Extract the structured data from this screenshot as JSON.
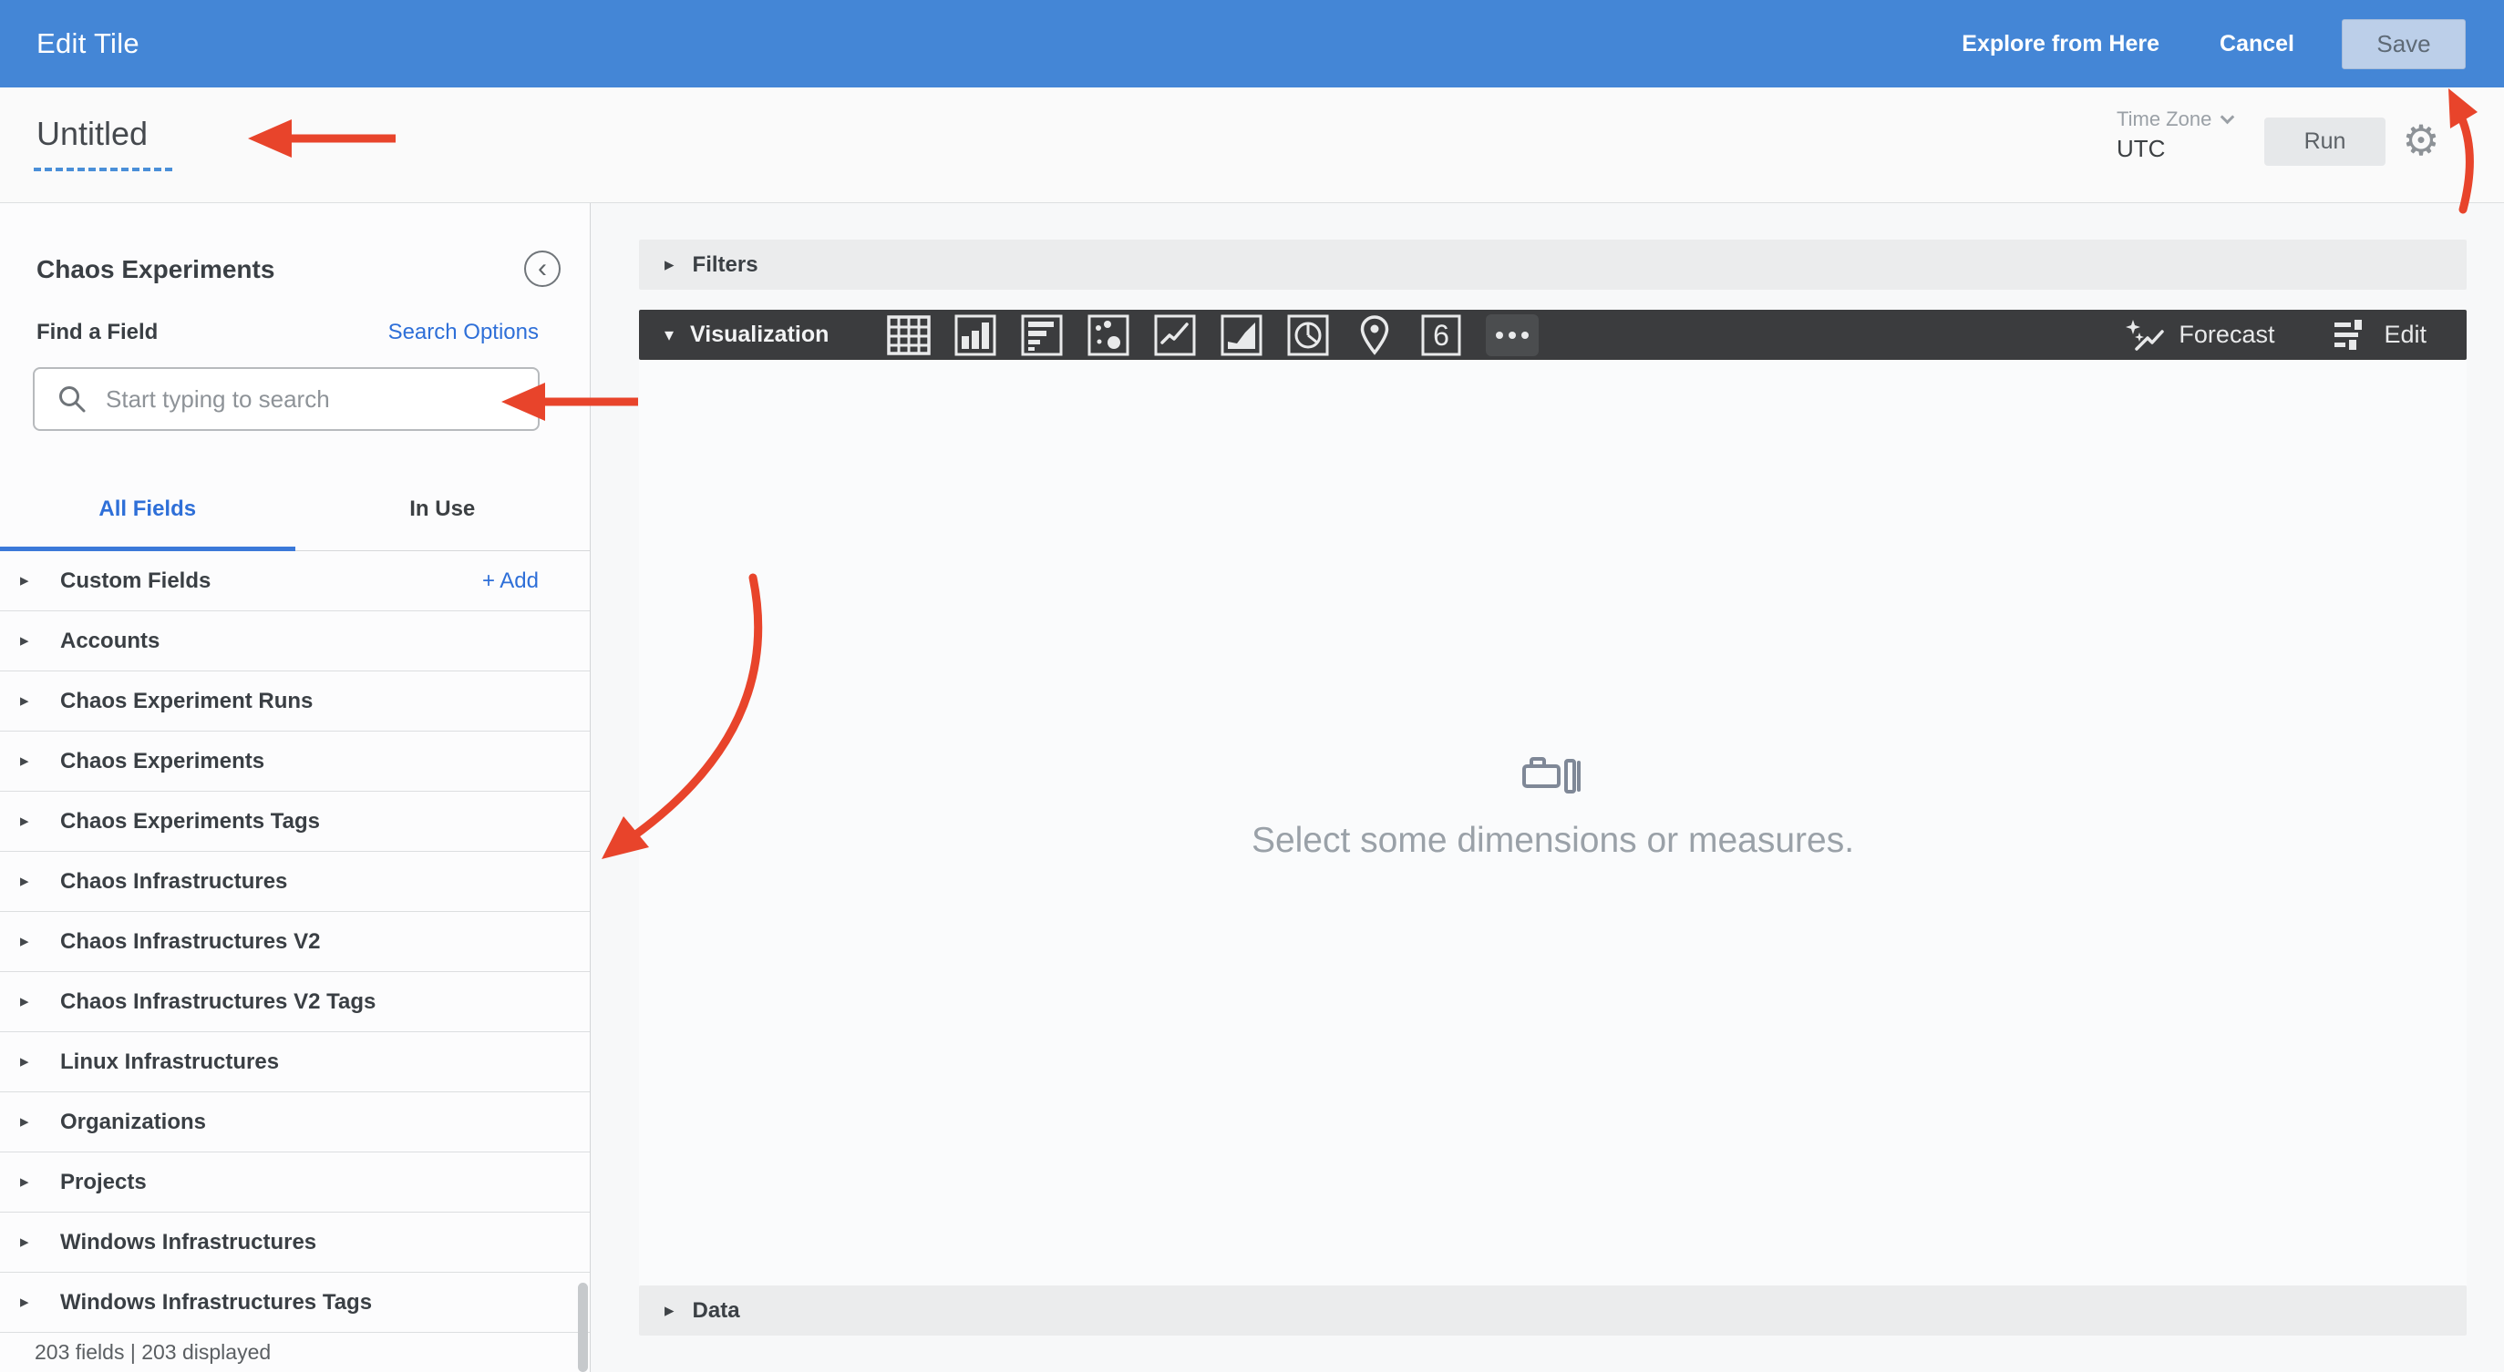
{
  "topbar": {
    "title": "Edit Tile",
    "explore_label": "Explore from Here",
    "cancel_label": "Cancel",
    "save_label": "Save"
  },
  "header": {
    "tile_title": "Untitled",
    "timezone_label": "Time Zone",
    "timezone_value": "UTC",
    "run_label": "Run"
  },
  "sidebar": {
    "title": "Chaos Experiments",
    "find_label": "Find a Field",
    "search_options_label": "Search Options",
    "search_placeholder": "Start typing to search",
    "tabs": [
      {
        "label": "All Fields",
        "active": true
      },
      {
        "label": "In Use",
        "active": false
      }
    ],
    "add_label": "+ Add",
    "fields": [
      {
        "label": "Custom Fields"
      },
      {
        "label": "Accounts"
      },
      {
        "label": "Chaos Experiment Runs"
      },
      {
        "label": "Chaos Experiments"
      },
      {
        "label": "Chaos Experiments Tags"
      },
      {
        "label": "Chaos Infrastructures"
      },
      {
        "label": "Chaos Infrastructures V2"
      },
      {
        "label": "Chaos Infrastructures V2 Tags"
      },
      {
        "label": "Linux Infrastructures"
      },
      {
        "label": "Organizations"
      },
      {
        "label": "Projects"
      },
      {
        "label": "Windows Infrastructures"
      },
      {
        "label": "Windows Infrastructures Tags"
      }
    ],
    "footer": "203 fields | 203 displayed"
  },
  "main": {
    "filters_label": "Filters",
    "visualization_label": "Visualization",
    "viz_types": [
      "table",
      "column",
      "bar",
      "scatter",
      "line",
      "area",
      "pie",
      "map",
      "single-value",
      "more-options"
    ],
    "forecast_label": "Forecast",
    "edit_label": "Edit",
    "empty_state_text": "Select some dimensions or measures.",
    "data_label": "Data"
  },
  "icons": {
    "search": "magnifier",
    "settings": "gear",
    "collapse_panel": "chevron-left-circle",
    "timezone": "chevron-down",
    "empty_state": "flashlight",
    "forecast": "sparkle-trend",
    "edit": "sliders"
  },
  "annotations": {
    "color": "#e8442b",
    "arrows": [
      "points-to-tile-title",
      "points-to-search-input",
      "points-to-field-list",
      "points-to-save-button"
    ]
  },
  "colors": {
    "topbar_blue": "#4486d6",
    "accent_blue": "#2e6fd8",
    "viz_bar_dark": "#3b3c3e",
    "save_button_bg": "#bccfe9",
    "annotation_red": "#e8442b"
  }
}
